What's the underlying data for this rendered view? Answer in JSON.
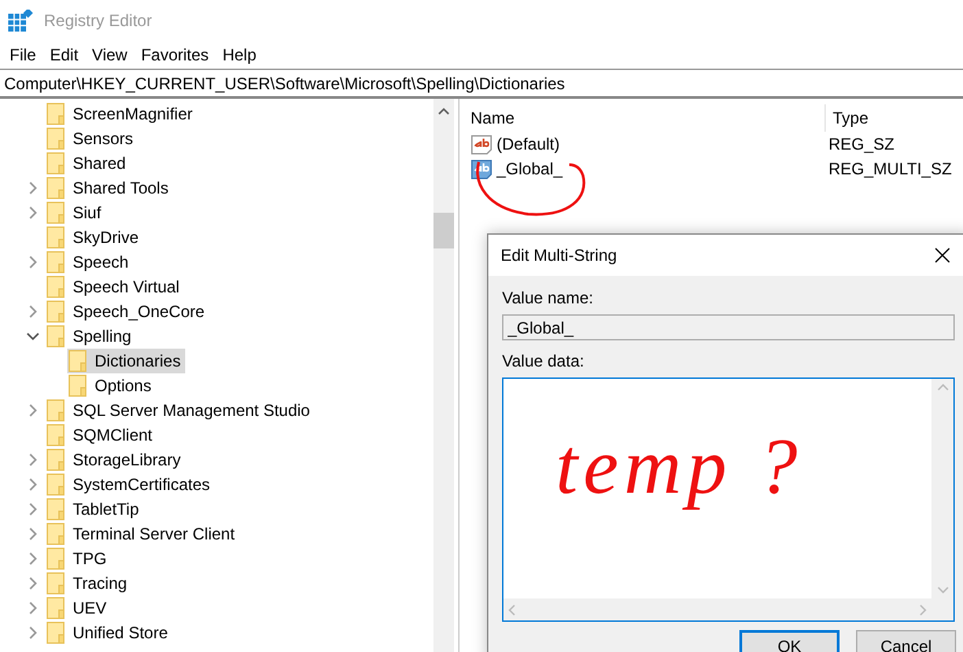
{
  "window": {
    "title": "Registry Editor"
  },
  "menu": [
    "File",
    "Edit",
    "View",
    "Favorites",
    "Help"
  ],
  "address": "Computer\\HKEY_CURRENT_USER\\Software\\Microsoft\\Spelling\\Dictionaries",
  "tree": [
    {
      "label": "ScreenMagnifier",
      "kind": "leaf",
      "selected": false
    },
    {
      "label": "Sensors",
      "kind": "leaf",
      "selected": false
    },
    {
      "label": "Shared",
      "kind": "leaf",
      "selected": false
    },
    {
      "label": "Shared Tools",
      "kind": "branch",
      "expanded": false,
      "selected": false
    },
    {
      "label": "Siuf",
      "kind": "branch",
      "expanded": false,
      "selected": false
    },
    {
      "label": "SkyDrive",
      "kind": "leaf",
      "selected": false
    },
    {
      "label": "Speech",
      "kind": "branch",
      "expanded": false,
      "selected": false
    },
    {
      "label": "Speech Virtual",
      "kind": "leaf",
      "selected": false
    },
    {
      "label": "Speech_OneCore",
      "kind": "branch",
      "expanded": false,
      "selected": false
    },
    {
      "label": "Spelling",
      "kind": "branch",
      "expanded": true,
      "selected": false,
      "children": [
        {
          "label": "Dictionaries",
          "kind": "leaf",
          "selected": true
        },
        {
          "label": "Options",
          "kind": "leaf",
          "selected": false
        }
      ]
    },
    {
      "label": "SQL Server Management Studio",
      "kind": "branch",
      "expanded": false,
      "selected": false
    },
    {
      "label": "SQMClient",
      "kind": "leaf",
      "selected": false
    },
    {
      "label": "StorageLibrary",
      "kind": "branch",
      "expanded": false,
      "selected": false
    },
    {
      "label": "SystemCertificates",
      "kind": "branch",
      "expanded": false,
      "selected": false
    },
    {
      "label": "TabletTip",
      "kind": "branch",
      "expanded": false,
      "selected": false
    },
    {
      "label": "Terminal Server Client",
      "kind": "branch",
      "expanded": false,
      "selected": false
    },
    {
      "label": "TPG",
      "kind": "branch",
      "expanded": false,
      "selected": false
    },
    {
      "label": "Tracing",
      "kind": "branch",
      "expanded": false,
      "selected": false
    },
    {
      "label": "UEV",
      "kind": "branch",
      "expanded": false,
      "selected": false
    },
    {
      "label": "Unified Store",
      "kind": "branch",
      "expanded": false,
      "selected": false
    }
  ],
  "values": {
    "columns": [
      "Name",
      "Type"
    ],
    "rows": [
      {
        "name": "(Default)",
        "type": "REG_SZ",
        "kind": "string",
        "selected": false
      },
      {
        "name": "_Global_",
        "type": "REG_MULTI_SZ",
        "kind": "multi",
        "selected": false
      }
    ]
  },
  "dialog": {
    "title": "Edit Multi-String",
    "value_name_label": "Value name:",
    "value_name": "_Global_",
    "value_data_label": "Value data:",
    "buttons": [
      {
        "label": "OK",
        "default": true
      },
      {
        "label": "Cancel",
        "default": false
      }
    ]
  },
  "annotation": {
    "text": "temp ?"
  }
}
